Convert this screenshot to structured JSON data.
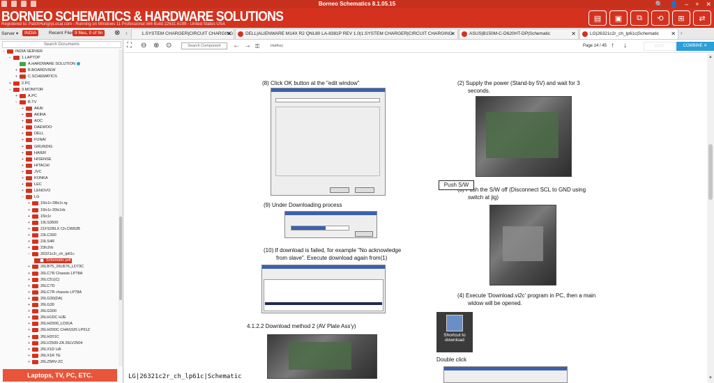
{
  "window": {
    "title": "Borneo Schematics 8.1.05.15",
    "controls": [
      "🔍",
      "👤",
      "–",
      "+",
      "✕"
    ]
  },
  "header": {
    "brand": "BORNEO SCHEMATICS & HARDWARE SOLUTIONS",
    "registration": "Registered to: PatchHungryLocal.com - Running on Windows 11 Professional x64 Build 22631.6199 - United States  USA",
    "buttons": [
      "▤",
      "▣",
      "⧉",
      "⟲",
      "⊞",
      "⇄"
    ]
  },
  "tabsbar": {
    "server_label": "Server ▾",
    "server_value": "INDIA",
    "recent_label": "Recent Files",
    "files_badge": "9 files, 0 of 9n",
    "tabs": [
      {
        "label": "1.SYSTEM CHARGER|CIRCUIT CHARGING",
        "active": false
      },
      {
        "label": "DELL|ALIENWARE M14X R2 QNL80 LA-8381P REV 1.0|1.SYSTEM CHARGER|CIRCUIT CHARGING",
        "active": false
      },
      {
        "label": "ASUS|B150M-C-D620HT-DP|Schematic",
        "active": false
      },
      {
        "label": "LG|26321c2r_ch_lp61c|Schematic",
        "active": true
      }
    ]
  },
  "sidebar": {
    "search_label": "Search Documents",
    "tree": [
      {
        "label": "INDIA SERVER",
        "level": 0,
        "type": "root",
        "exp": "−"
      },
      {
        "label": "1.LAPTOP",
        "level": 1,
        "type": "folder",
        "exp": "−"
      },
      {
        "label": "A.HARDWARE SOLUTION",
        "level": 2,
        "type": "green",
        "exp": ""
      },
      {
        "label": "B.BOARDVIEW",
        "level": 2,
        "type": "folder",
        "exp": "+"
      },
      {
        "label": "C.SCHEMATICS",
        "level": 2,
        "type": "folder",
        "exp": "+"
      },
      {
        "label": "2.PC",
        "level": 1,
        "type": "folder",
        "exp": "+"
      },
      {
        "label": "3.MONITOR",
        "level": 1,
        "type": "folder",
        "exp": "−"
      },
      {
        "label": "A.PC",
        "level": 2,
        "type": "folder",
        "exp": "+"
      },
      {
        "label": "B.TV",
        "level": 2,
        "type": "folder",
        "exp": "−"
      },
      {
        "label": "AKAI",
        "level": 3,
        "type": "folder",
        "exp": "+"
      },
      {
        "label": "AKIRA",
        "level": 3,
        "type": "folder",
        "exp": "+"
      },
      {
        "label": "AOC",
        "level": 3,
        "type": "folder",
        "exp": "+"
      },
      {
        "label": "DAEWOO",
        "level": 3,
        "type": "folder",
        "exp": "+"
      },
      {
        "label": "DELL",
        "level": 3,
        "type": "folder",
        "exp": "+"
      },
      {
        "label": "FUNAI",
        "level": 3,
        "type": "folder",
        "exp": "+"
      },
      {
        "label": "GRUNDIG",
        "level": 3,
        "type": "folder",
        "exp": "+"
      },
      {
        "label": "HAIER",
        "level": 3,
        "type": "folder",
        "exp": "+"
      },
      {
        "label": "HISENSE",
        "level": 3,
        "type": "folder",
        "exp": "+"
      },
      {
        "label": "HITACHI",
        "level": 3,
        "type": "folder",
        "exp": "+"
      },
      {
        "label": "JVC",
        "level": 3,
        "type": "folder",
        "exp": "+"
      },
      {
        "label": "KONKA",
        "level": 3,
        "type": "folder",
        "exp": "+"
      },
      {
        "label": "LEC",
        "level": 3,
        "type": "folder",
        "exp": "+"
      },
      {
        "label": "LENOVO",
        "level": 3,
        "type": "folder",
        "exp": "+"
      },
      {
        "label": "LG",
        "level": 3,
        "type": "folder",
        "exp": "−"
      },
      {
        "label": "15lc1r-28lc1r.rg",
        "level": 4,
        "type": "folder",
        "exp": "+"
      },
      {
        "label": "15lc1r-20lc1rb",
        "level": 4,
        "type": "folder",
        "exp": "+"
      },
      {
        "label": "15lc1r",
        "level": 4,
        "type": "folder",
        "exp": "+"
      },
      {
        "label": "19LS3500",
        "level": 4,
        "type": "folder",
        "exp": "+"
      },
      {
        "label": "21FS2RLX Ch.CW62B",
        "level": 4,
        "type": "folder",
        "exp": "+"
      },
      {
        "label": "23LC300",
        "level": 4,
        "type": "folder",
        "exp": "+"
      },
      {
        "label": "23LS4R",
        "level": 4,
        "type": "folder",
        "exp": "+"
      },
      {
        "label": "23lc2rb",
        "level": 4,
        "type": "folder",
        "exp": "+"
      },
      {
        "label": "26321c2r_ch_lp61c",
        "level": 4,
        "type": "folder",
        "exp": "−"
      },
      {
        "label": "Schematic.pdf",
        "level": 5,
        "type": "file",
        "exp": "",
        "selected": true
      },
      {
        "label": "26LB75_26LB76_LD73C",
        "level": 4,
        "type": "folder",
        "exp": "+"
      },
      {
        "label": "26LC7R Chassis LP78A",
        "level": 4,
        "type": "folder",
        "exp": "+"
      },
      {
        "label": "26LC51(C)",
        "level": 4,
        "type": "folder",
        "exp": "+"
      },
      {
        "label": "26LC7D",
        "level": 4,
        "type": "folder",
        "exp": "+"
      },
      {
        "label": "26LC7R chassis LP78A",
        "level": 4,
        "type": "folder",
        "exp": "+"
      },
      {
        "label": "26LG30(DA)",
        "level": 4,
        "type": "folder",
        "exp": "+"
      },
      {
        "label": "26LG30",
        "level": 4,
        "type": "folder",
        "exp": "+"
      },
      {
        "label": "26LG300",
        "level": 4,
        "type": "folder",
        "exp": "+"
      },
      {
        "label": "26LH1DC HJE",
        "level": 4,
        "type": "folder",
        "exp": "+"
      },
      {
        "label": "26LH2000_LD91A",
        "level": 4,
        "type": "folder",
        "exp": "+"
      },
      {
        "label": "26LH200C CHASSIS LP91Z",
        "level": 4,
        "type": "folder",
        "exp": "+"
      },
      {
        "label": "26LH201C",
        "level": 4,
        "type": "folder",
        "exp": "+"
      },
      {
        "label": "26LV2500-ZA 26LV2504",
        "level": 4,
        "type": "folder",
        "exp": "+"
      },
      {
        "label": "26LX1D UA",
        "level": 4,
        "type": "folder",
        "exp": "+"
      },
      {
        "label": "26LX1R TE",
        "level": 4,
        "type": "folder",
        "exp": "+"
      },
      {
        "label": "26LZ5RV-ZC",
        "level": 4,
        "type": "folder",
        "exp": "+"
      }
    ],
    "bottom_button": "Laptops, TV, PC, ETC."
  },
  "toolbar": {
    "icons": [
      "⛶",
      "⊖",
      "⊕",
      "⊙"
    ],
    "search_placeholder": "Search Component",
    "hotkey": "HotKey",
    "page_info": "Page 14 / 45",
    "edit_label": "EDIT",
    "combine_label": "COMBINE ✕"
  },
  "document": {
    "step8": "(8)  Click OK button at the \"edit window\"",
    "step9": "(9) Under Downloading process",
    "step10a": "(10) If download is failed, for example \"No acknowledge",
    "step10b": "from slave\". Execute download again from(1)",
    "section": "4.1.2.2 Download method 2 (AV Plate Ass'y)",
    "step2a": "(2) Supply the power (Stand-by 5V) and wait for 3",
    "step2b": "seconds.",
    "step3a": "(3) Push the S/W off (Disconnect SCL to GND using",
    "step3b": "switch at jig)",
    "pushsw": "Push S/W",
    "step4a": "(4) Execute 'Download.vi2c' program in PC, then a main",
    "step4b": "widow will be opened.",
    "shortcut": "Shortcut to download",
    "doubleclick": "Double click",
    "doc_label": "LG|26321c2r_ch_lp61c|Schematic"
  }
}
